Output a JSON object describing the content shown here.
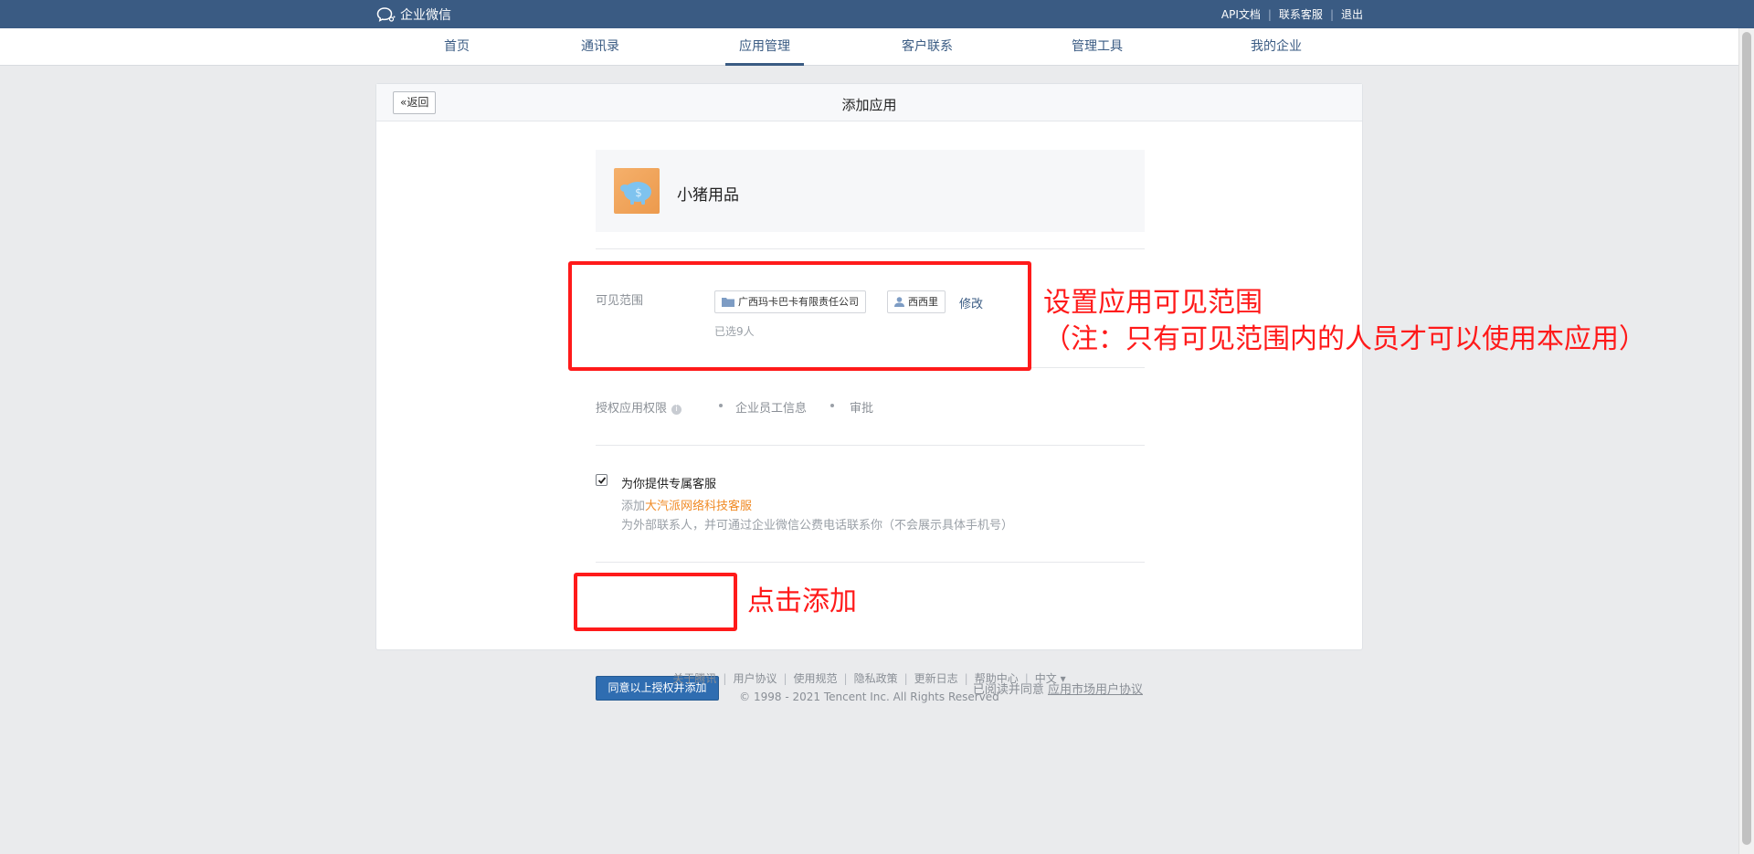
{
  "topbar": {
    "brand": "企业微信",
    "links": [
      "API文档",
      "联系客服",
      "退出"
    ]
  },
  "nav": {
    "items": [
      "首页",
      "通讯录",
      "应用管理",
      "客户联系",
      "管理工具",
      "我的企业"
    ],
    "active_index": 2
  },
  "page": {
    "back_label": "返回",
    "title": "添加应用"
  },
  "app": {
    "name": "小猪用品",
    "logo_icon": "piggy-bank-icon"
  },
  "scope": {
    "label": "可见范围",
    "department": "广西玛卡巴卡有限责任公司",
    "member": "西西里",
    "modify": "修改",
    "count": "已选9人"
  },
  "permissions": {
    "label": "授权应用权限",
    "items": [
      "企业员工信息",
      "审批"
    ]
  },
  "service": {
    "checked": true,
    "title": "为你提供专属客服",
    "desc_prefix": "添加",
    "desc_highlight": "大汽派网络科技客服",
    "desc_suffix": "为外部联系人，并可通过企业微信公费电话联系你（不会展示具体手机号）"
  },
  "actions": {
    "submit": "同意以上授权并添加",
    "agree_prefix": "已阅读并同意",
    "agree_link": "应用市场用户协议"
  },
  "footer": {
    "links": [
      "关于腾讯",
      "用户协议",
      "使用规范",
      "隐私政策",
      "更新日志",
      "帮助中心",
      "中文 ▾"
    ],
    "copyright": "© 1998 - 2021 Tencent Inc. All Rights Reserved"
  },
  "annotations": {
    "scope_line1": "设置应用可见范围",
    "scope_line2": "（注：只有可见范围内的人员才可以使用本应用）",
    "add": "点击添加",
    "color": "#ff1a1a"
  },
  "colors": {
    "brand": "#3a5b83",
    "primary": "#2f6db1",
    "highlight": "#f08a24"
  }
}
